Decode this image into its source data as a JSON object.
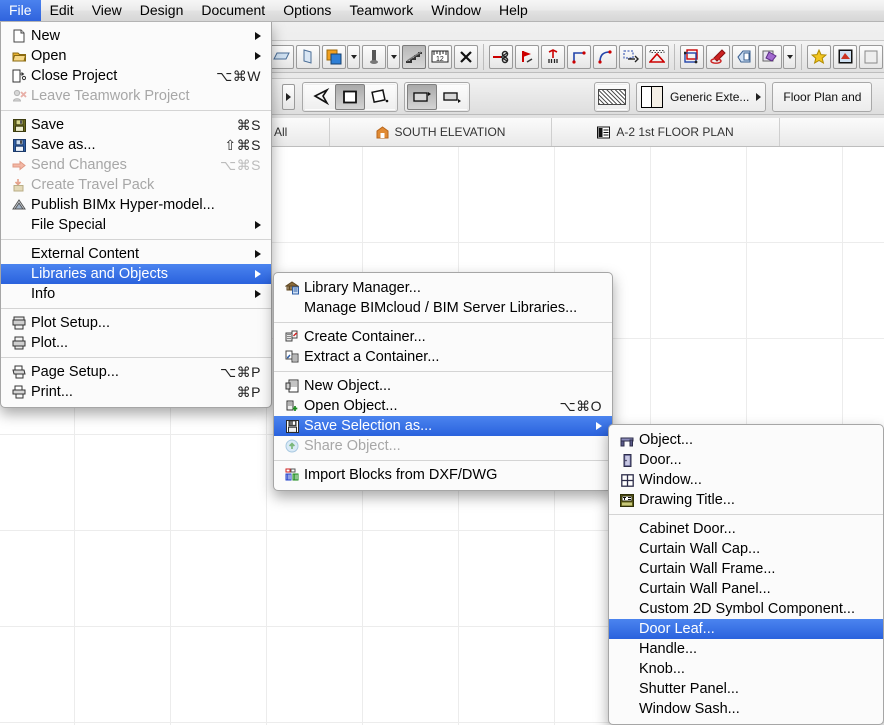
{
  "app": {
    "menubar": [
      {
        "label": "File",
        "active": true
      },
      {
        "label": "Edit",
        "active": false
      },
      {
        "label": "View",
        "active": false
      },
      {
        "label": "Design",
        "active": false
      },
      {
        "label": "Document",
        "active": false
      },
      {
        "label": "Options",
        "active": false
      },
      {
        "label": "Teamwork",
        "active": false
      },
      {
        "label": "Window",
        "active": false
      },
      {
        "label": "Help",
        "active": false
      }
    ]
  },
  "toolbar": {
    "material_combo_label": "Generic Exte...",
    "view_combo_label": "Floor Plan and"
  },
  "tabs": [
    {
      "label": "/ All",
      "icon": ""
    },
    {
      "label": "SOUTH ELEVATION",
      "icon": "house-icon"
    },
    {
      "label": "A-2 1st FLOOR PLAN",
      "icon": "floorplan-icon"
    }
  ],
  "file_menu": {
    "groups": [
      {
        "items": [
          {
            "label": "New",
            "icon": "new-document-icon",
            "shortcut": "",
            "submenu": true,
            "disabled": false,
            "highlighted": false
          },
          {
            "label": "Open",
            "icon": "open-folder-icon",
            "shortcut": "",
            "submenu": true,
            "disabled": false,
            "highlighted": false
          },
          {
            "label": "Close Project",
            "icon": "close-project-icon",
            "shortcut": "⌥⌘W",
            "submenu": false,
            "disabled": false,
            "highlighted": false
          },
          {
            "label": "Leave Teamwork Project",
            "icon": "leave-teamwork-icon",
            "shortcut": "",
            "submenu": false,
            "disabled": true,
            "highlighted": false
          }
        ]
      },
      {
        "items": [
          {
            "label": "Save",
            "icon": "save-disk-icon",
            "shortcut": "⌘S",
            "submenu": false,
            "disabled": false,
            "highlighted": false
          },
          {
            "label": "Save as...",
            "icon": "save-as-disk-icon",
            "shortcut": "⇧⌘S",
            "submenu": false,
            "disabled": false,
            "highlighted": false
          },
          {
            "label": "Send Changes",
            "icon": "send-changes-arrow-icon",
            "shortcut": "⌥⌘S",
            "submenu": false,
            "disabled": true,
            "highlighted": false
          },
          {
            "label": "Create Travel Pack",
            "icon": "travel-pack-icon",
            "shortcut": "",
            "submenu": false,
            "disabled": true,
            "highlighted": false
          },
          {
            "label": "Publish BIMx Hyper-model...",
            "icon": "bimx-icon",
            "shortcut": "",
            "submenu": false,
            "disabled": false,
            "highlighted": false
          },
          {
            "label": "File Special",
            "icon": "",
            "shortcut": "",
            "submenu": true,
            "disabled": false,
            "highlighted": false
          }
        ]
      },
      {
        "items": [
          {
            "label": "External Content",
            "icon": "",
            "shortcut": "",
            "submenu": true,
            "disabled": false,
            "highlighted": false
          },
          {
            "label": "Libraries and Objects",
            "icon": "",
            "shortcut": "",
            "submenu": true,
            "disabled": false,
            "highlighted": true
          },
          {
            "label": "Info",
            "icon": "",
            "shortcut": "",
            "submenu": true,
            "disabled": false,
            "highlighted": false
          }
        ]
      },
      {
        "items": [
          {
            "label": "Plot Setup...",
            "icon": "plotter-icon",
            "shortcut": "",
            "submenu": false,
            "disabled": false,
            "highlighted": false
          },
          {
            "label": "Plot...",
            "icon": "plotter-icon",
            "shortcut": "",
            "submenu": false,
            "disabled": false,
            "highlighted": false
          }
        ]
      },
      {
        "items": [
          {
            "label": "Page Setup...",
            "icon": "printer-setup-icon",
            "shortcut": "⌥⌘P",
            "submenu": false,
            "disabled": false,
            "highlighted": false
          },
          {
            "label": "Print...",
            "icon": "printer-icon",
            "shortcut": "⌘P",
            "submenu": false,
            "disabled": false,
            "highlighted": false
          }
        ]
      }
    ]
  },
  "libraries_menu": {
    "groups": [
      {
        "items": [
          {
            "label": "Library Manager...",
            "icon": "library-manager-icon",
            "shortcut": "",
            "submenu": false,
            "disabled": false,
            "highlighted": false
          },
          {
            "label": "Manage BIMcloud / BIM Server Libraries...",
            "icon": "",
            "shortcut": "",
            "submenu": false,
            "disabled": false,
            "highlighted": false
          }
        ]
      },
      {
        "items": [
          {
            "label": "Create Container...",
            "icon": "create-container-icon",
            "shortcut": "",
            "submenu": false,
            "disabled": false,
            "highlighted": false
          },
          {
            "label": "Extract a Container...",
            "icon": "extract-container-icon",
            "shortcut": "",
            "submenu": false,
            "disabled": false,
            "highlighted": false
          }
        ]
      },
      {
        "items": [
          {
            "label": "New Object...",
            "icon": "new-object-icon",
            "shortcut": "",
            "submenu": false,
            "disabled": false,
            "highlighted": false
          },
          {
            "label": "Open Object...",
            "icon": "open-object-icon",
            "shortcut": "⌥⌘O",
            "submenu": false,
            "disabled": false,
            "highlighted": false
          },
          {
            "label": "Save Selection as...",
            "icon": "save-disk-icon",
            "shortcut": "",
            "submenu": true,
            "disabled": false,
            "highlighted": true
          },
          {
            "label": "Share Object...",
            "icon": "share-object-icon",
            "shortcut": "",
            "submenu": false,
            "disabled": true,
            "highlighted": false
          }
        ]
      },
      {
        "items": [
          {
            "label": "Import Blocks from DXF/DWG",
            "icon": "import-blocks-icon",
            "shortcut": "",
            "submenu": false,
            "disabled": false,
            "highlighted": false
          }
        ]
      }
    ]
  },
  "save_selection_menu": {
    "groups": [
      {
        "items": [
          {
            "label": "Object...",
            "icon": "chair-object-icon",
            "shortcut": "",
            "submenu": false,
            "disabled": false,
            "highlighted": false
          },
          {
            "label": "Door...",
            "icon": "door-icon",
            "shortcut": "",
            "submenu": false,
            "disabled": false,
            "highlighted": false
          },
          {
            "label": "Window...",
            "icon": "window-icon",
            "shortcut": "",
            "submenu": false,
            "disabled": false,
            "highlighted": false
          },
          {
            "label": "Drawing Title...",
            "icon": "drawing-title-icon",
            "shortcut": "",
            "submenu": false,
            "disabled": false,
            "highlighted": false
          }
        ]
      },
      {
        "items": [
          {
            "label": "Cabinet Door...",
            "icon": "",
            "shortcut": "",
            "submenu": false,
            "disabled": false,
            "highlighted": false
          },
          {
            "label": "Curtain Wall Cap...",
            "icon": "",
            "shortcut": "",
            "submenu": false,
            "disabled": false,
            "highlighted": false
          },
          {
            "label": "Curtain Wall Frame...",
            "icon": "",
            "shortcut": "",
            "submenu": false,
            "disabled": false,
            "highlighted": false
          },
          {
            "label": "Curtain Wall Panel...",
            "icon": "",
            "shortcut": "",
            "submenu": false,
            "disabled": false,
            "highlighted": false
          },
          {
            "label": "Custom 2D Symbol Component...",
            "icon": "",
            "shortcut": "",
            "submenu": false,
            "disabled": false,
            "highlighted": false
          },
          {
            "label": "Door Leaf...",
            "icon": "",
            "shortcut": "",
            "submenu": false,
            "disabled": false,
            "highlighted": true
          },
          {
            "label": "Handle...",
            "icon": "",
            "shortcut": "",
            "submenu": false,
            "disabled": false,
            "highlighted": false
          },
          {
            "label": "Knob...",
            "icon": "",
            "shortcut": "",
            "submenu": false,
            "disabled": false,
            "highlighted": false
          },
          {
            "label": "Shutter Panel...",
            "icon": "",
            "shortcut": "",
            "submenu": false,
            "disabled": false,
            "highlighted": false
          },
          {
            "label": "Window Sash...",
            "icon": "",
            "shortcut": "",
            "submenu": false,
            "disabled": false,
            "highlighted": false
          }
        ]
      }
    ]
  },
  "colors": {
    "menu_highlight": "#2a62dd",
    "menubar_active": "#3b6ee8",
    "menu_background": "#fbfbfb",
    "disabled_text": "#a7a7a7",
    "grid_line": "#ececec"
  }
}
